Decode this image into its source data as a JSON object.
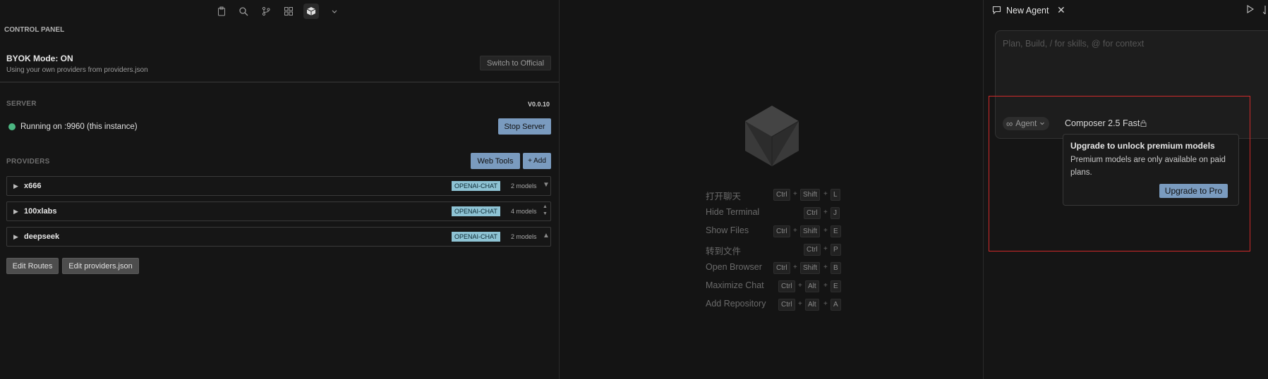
{
  "toolbar": {
    "icons": [
      "clipboard-icon",
      "search-icon",
      "source-control-icon",
      "extensions-icon",
      "cube-icon",
      "chevron-down-icon"
    ]
  },
  "control_panel": {
    "title": "CONTROL PANEL",
    "byok": {
      "title": "BYOK Mode: ON",
      "subtitle": "Using your own providers from providers.json",
      "switch_label": "Switch to Official"
    },
    "server": {
      "title": "SERVER",
      "version": "V0.0.10",
      "status_text": "Running on :9960 (this instance)",
      "status_color": "#4cb782",
      "stop_label": "Stop Server"
    },
    "providers": {
      "title": "PROVIDERS",
      "web_tools_label": "Web Tools",
      "add_label": "+ Add",
      "items": [
        {
          "name": "x666",
          "badge": "OPENAI-CHAT",
          "count": "2 models",
          "caret": "▼"
        },
        {
          "name": "100xlabs",
          "badge": "OPENAI-CHAT",
          "count": "4 models",
          "caret": "▲▼"
        },
        {
          "name": "deepseek",
          "badge": "OPENAI-CHAT",
          "count": "2 models",
          "caret": "▲"
        }
      ]
    },
    "edit_routes_label": "Edit Routes",
    "edit_providers_label": "Edit providers.json"
  },
  "shortcuts": [
    {
      "label": "打开聊天",
      "keys": [
        "Ctrl",
        "Shift",
        "L"
      ]
    },
    {
      "label": "Hide Terminal",
      "keys": [
        "Ctrl",
        "J"
      ]
    },
    {
      "label": "Show Files",
      "keys": [
        "Ctrl",
        "Shift",
        "E"
      ]
    },
    {
      "label": "转到文件",
      "keys": [
        "Ctrl",
        "P"
      ]
    },
    {
      "label": "Open Browser",
      "keys": [
        "Ctrl",
        "Shift",
        "B"
      ]
    },
    {
      "label": "Maximize Chat",
      "keys": [
        "Ctrl",
        "Alt",
        "E"
      ]
    },
    {
      "label": "Add Repository",
      "keys": [
        "Ctrl",
        "Alt",
        "A"
      ]
    }
  ],
  "agent_panel": {
    "tab_label": "New Agent",
    "input_placeholder": "Plan, Build, / for skills, @ for context",
    "mode_label": "Agent",
    "model_label": "Composer 2.5 Fast",
    "popup": {
      "title": "Upgrade to unlock premium models",
      "body": "Premium models are only available on paid plans.",
      "button_label": "Upgrade to Pro"
    },
    "highlight_color": "#d02a2a"
  }
}
